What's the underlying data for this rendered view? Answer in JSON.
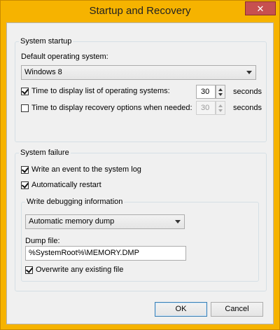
{
  "window": {
    "title": "Startup and Recovery",
    "close_label": "✕"
  },
  "system_startup": {
    "legend": "System startup",
    "default_os_label": "Default operating system:",
    "default_os_value": "Windows 8",
    "display_list_label": "Time to display list of operating systems:",
    "display_list_checked": true,
    "display_list_value": "30",
    "display_list_unit": "seconds",
    "recovery_label": "Time to display recovery options when needed:",
    "recovery_checked": false,
    "recovery_value": "30",
    "recovery_unit": "seconds"
  },
  "system_failure": {
    "legend": "System failure",
    "write_event_label": "Write an event to the system log",
    "write_event_checked": true,
    "auto_restart_label": "Automatically restart",
    "auto_restart_checked": true,
    "debug_legend": "Write debugging information",
    "dump_type_value": "Automatic memory dump",
    "dump_file_label": "Dump file:",
    "dump_file_value": "%SystemRoot%\\MEMORY.DMP",
    "overwrite_label": "Overwrite any existing file",
    "overwrite_checked": true
  },
  "buttons": {
    "ok": "OK",
    "cancel": "Cancel"
  }
}
